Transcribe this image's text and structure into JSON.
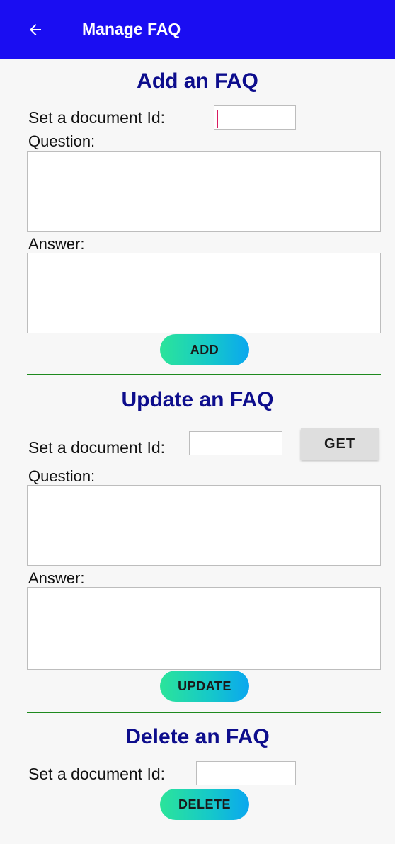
{
  "app_bar": {
    "back_icon": "arrow-left-icon",
    "title": "Manage FAQ"
  },
  "add_section": {
    "title": "Add an FAQ",
    "doc_id_label": "Set a document Id:",
    "doc_id_value": "",
    "question_label": "Question:",
    "question_value": "",
    "answer_label": "Answer:",
    "answer_value": "",
    "button_label": "ADD"
  },
  "update_section": {
    "title": "Update an FAQ",
    "doc_id_label": "Set a document Id:",
    "doc_id_value": "",
    "get_button_label": "GET",
    "question_label": "Question:",
    "question_value": "",
    "answer_label": "Answer:",
    "answer_value": "",
    "button_label": "UPDATE"
  },
  "delete_section": {
    "title": "Delete an FAQ",
    "doc_id_label": "Set a document Id:",
    "doc_id_value": "",
    "button_label": "DELETE"
  },
  "colors": {
    "app_bar": "#1a0df2",
    "section_title": "#0d0d8c",
    "divider": "#1e8a1e",
    "caret": "#d81b60",
    "pill_gradient_start": "#2be49a",
    "pill_gradient_end": "#0aa7ef"
  }
}
